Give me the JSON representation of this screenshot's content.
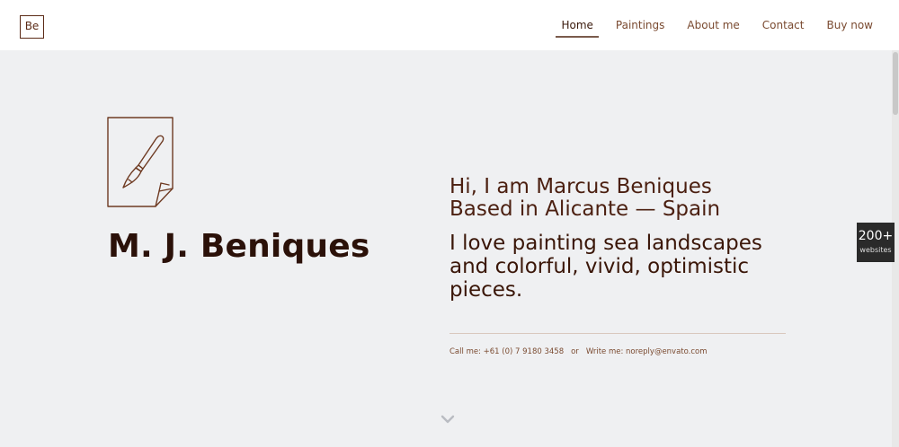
{
  "header": {
    "logo_text": "Be",
    "nav": [
      {
        "label": "Home",
        "active": true
      },
      {
        "label": "Paintings",
        "active": false
      },
      {
        "label": "About me",
        "active": false
      },
      {
        "label": "Contact",
        "active": false
      },
      {
        "label": "Buy now",
        "active": false
      }
    ]
  },
  "hero": {
    "icon": "paintbrush-icon",
    "title": "M. J. Beniques",
    "intro_line1": "Hi, I am Marcus Beniques",
    "intro_line2": "Based in Alicante — Spain",
    "tagline": "I love painting sea landscapes and colorful, vivid, optimistic pieces.",
    "call_label": "Call me: +61 (0) 7 9180 3458",
    "or_label": "or",
    "write_label": "Write me: noreply@envato.com",
    "scroll_icon": "chevron-down-icon"
  },
  "badge": {
    "count": "200+",
    "label": "websites"
  },
  "colors": {
    "accent": "#5b2a16",
    "title": "#2b1109",
    "background": "#eff0f2"
  }
}
